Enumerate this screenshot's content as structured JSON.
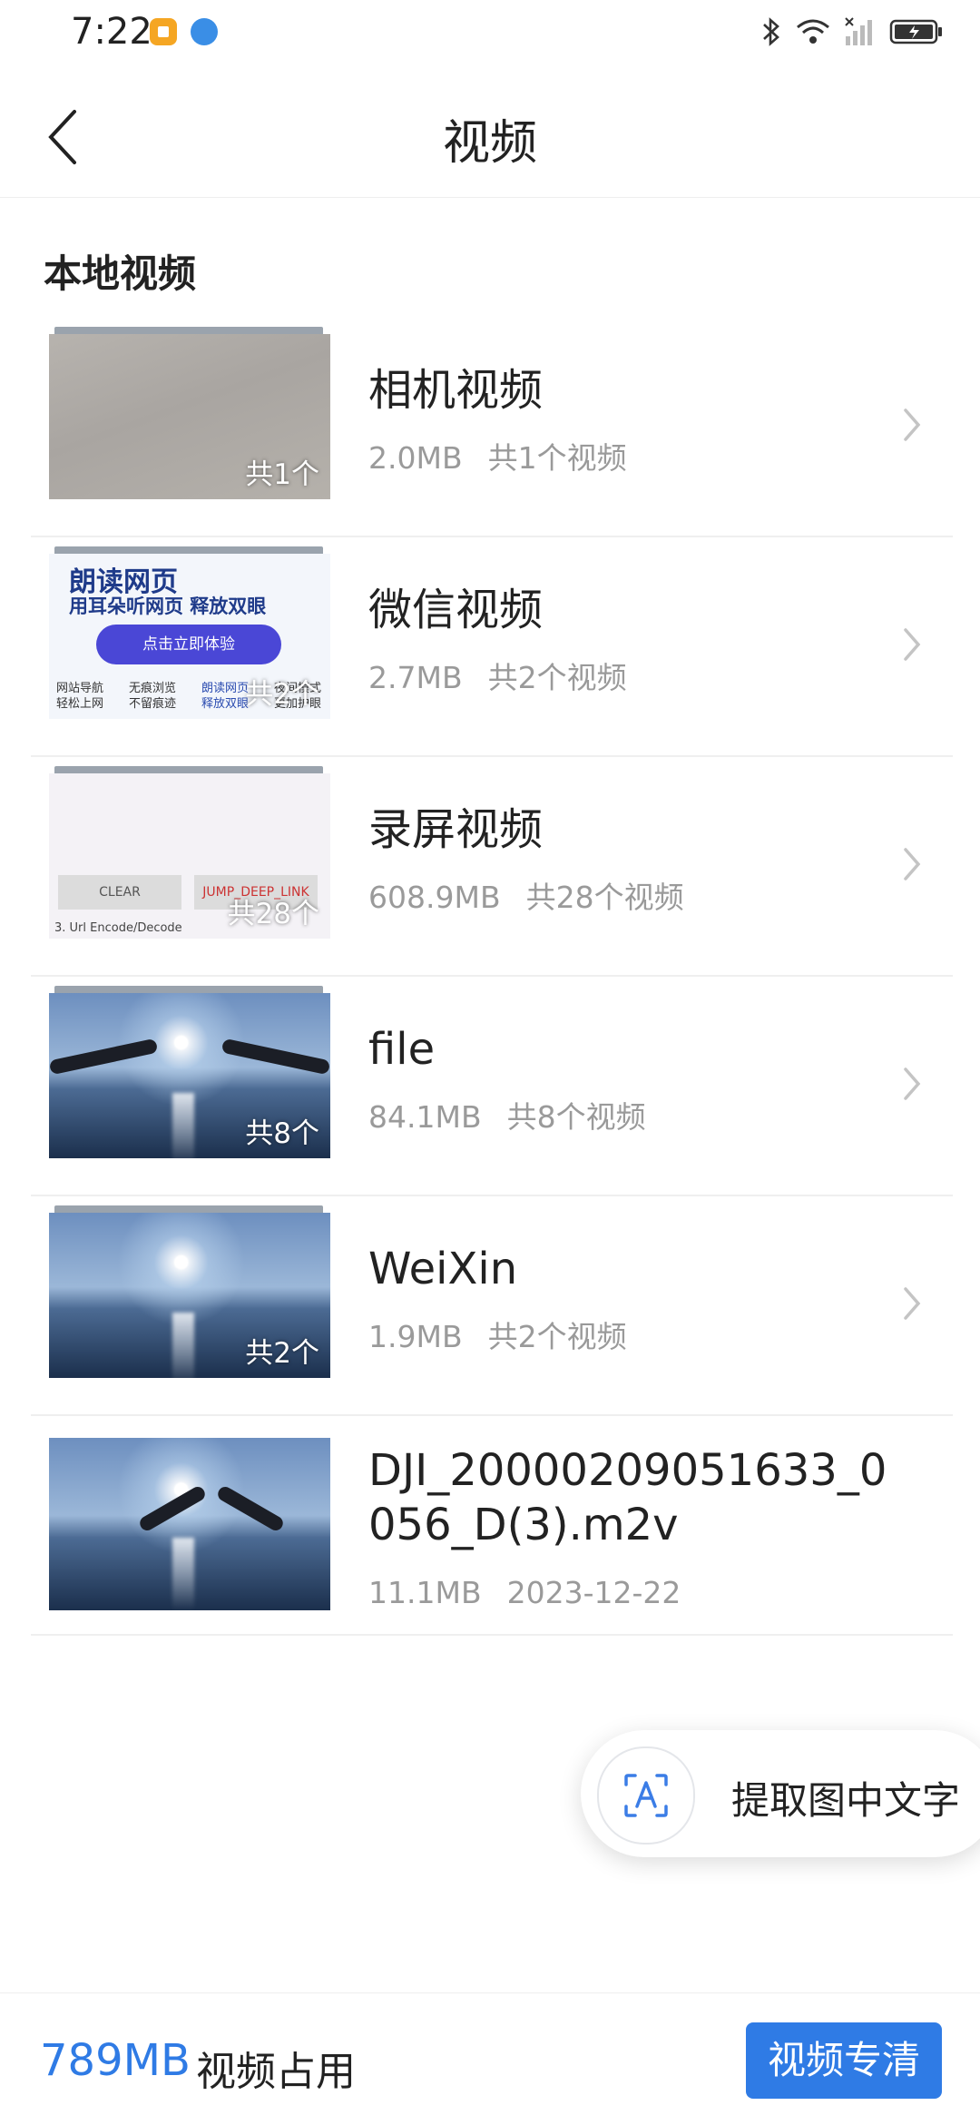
{
  "status_bar": {
    "time": "7:22"
  },
  "header": {
    "title": "视频"
  },
  "section": {
    "label": "本地视频"
  },
  "items": [
    {
      "name": "相机视频",
      "size": "2.0MB",
      "count": "共1个视频",
      "thumb_count": "共1个"
    },
    {
      "name": "微信视频",
      "size": "2.7MB",
      "count": "共2个视频",
      "thumb_count": "共2个",
      "thumb_text": {
        "title": "朗读网页",
        "subtitle": "用耳朵听网页 释放双眼",
        "button": "点击立即体验",
        "col1": "网站导航 轻松上网",
        "col2": "无痕浏览 不留痕迹",
        "col3": "朗读网页 释放双眼",
        "col4": "夜间模式 更加护眼"
      }
    },
    {
      "name": "录屏视频",
      "size": "608.9MB",
      "count": "共28个视频",
      "thumb_count": "共28个",
      "thumb_text": {
        "btn1": "CLEAR",
        "btn2": "JUMP_DEEP_LINK",
        "caption": "3. Url Encode/Decode"
      }
    },
    {
      "name": "file",
      "size": "84.1MB",
      "count": "共8个视频",
      "thumb_count": "共8个"
    },
    {
      "name": "WeiXin",
      "size": "1.9MB",
      "count": "共2个视频",
      "thumb_count": "共2个"
    },
    {
      "name": "DJI_20000209051633_0056_D(3).m2v",
      "size": "11.1MB",
      "date": "2023-12-22"
    }
  ],
  "ocr": {
    "label": "提取图中文字"
  },
  "footer": {
    "usage_value": "789MB",
    "usage_label": "视频占用",
    "button": "视频专清"
  },
  "colors": {
    "accent": "#2f7be5",
    "meta_text": "#9a9a9a",
    "divider": "#efefef"
  },
  "icons": [
    "back-arrow-icon",
    "chevron-right-icon",
    "text-scan-icon",
    "bluetooth-icon",
    "wifi-icon",
    "signal-icon",
    "battery-icon"
  ]
}
